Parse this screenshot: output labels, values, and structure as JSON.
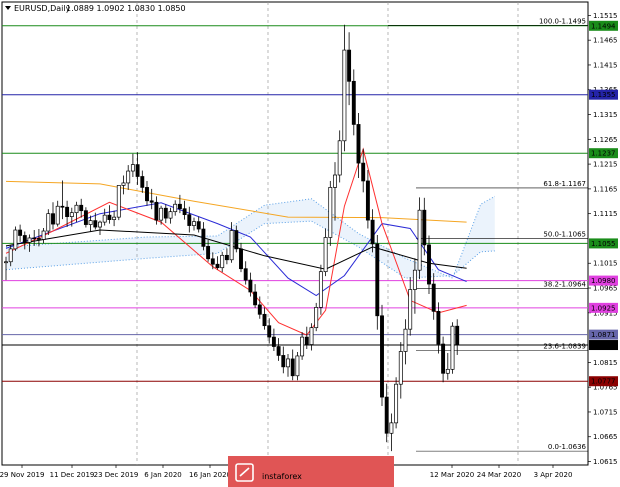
{
  "chart_data": {
    "type": "candlestick",
    "title": "EURUSD,Daily",
    "ohlc_header": "1.0889 1.0902 1.0830 1.0850",
    "ylim": [
      1.0608,
      1.1542
    ],
    "y_ticks": [
      {
        "value": 1.1515,
        "label": "1.1515"
      },
      {
        "value": 1.1465,
        "label": "1.1465"
      },
      {
        "value": 1.1415,
        "label": "1.1415"
      },
      {
        "value": 1.1365,
        "label": "1.1365"
      },
      {
        "value": 1.1315,
        "label": "1.1315"
      },
      {
        "value": 1.1265,
        "label": "1.1265"
      },
      {
        "value": 1.1215,
        "label": "1.1215"
      },
      {
        "value": 1.1165,
        "label": "1.1165"
      },
      {
        "value": 1.1115,
        "label": "1.1115"
      },
      {
        "value": 1.1015,
        "label": "1.1015"
      },
      {
        "value": 1.0965,
        "label": "1.0965"
      },
      {
        "value": 1.0915,
        "label": "1.0915"
      },
      {
        "value": 1.0815,
        "label": "1.0815"
      },
      {
        "value": 1.0765,
        "label": "1.0765"
      },
      {
        "value": 1.0715,
        "label": "1.0715"
      },
      {
        "value": 1.0665,
        "label": "1.0665"
      },
      {
        "value": 1.0615,
        "label": "1.0615"
      }
    ],
    "x_labels": [
      "29 Nov 2019",
      "11 Dec 2019",
      "23 Dec 2019",
      "6 Jan 2020",
      "16 Jan 2020",
      "",
      "",
      "",
      "12 Mar 2020",
      "24 Mar 2020",
      "3 Apr 2020"
    ],
    "h_levels": [
      {
        "value": 1.1494,
        "label": "1.1494",
        "color": "#1a8c1a"
      },
      {
        "value": 1.1355,
        "label": "1.1355",
        "color": "#2424a8"
      },
      {
        "value": 1.1237,
        "label": "1.1237",
        "color": "#1a8c1a"
      },
      {
        "value": 1.1055,
        "label": "1.1055",
        "color": "#1a8c1a"
      },
      {
        "value": 1.098,
        "label": "1.0980",
        "color": "#e040e0"
      },
      {
        "value": 1.0925,
        "label": "1.0925",
        "color": "#e040e0"
      },
      {
        "value": 1.0871,
        "label": "1.0871",
        "color": "#6666aa"
      },
      {
        "value": 1.085,
        "label": "1.0850",
        "color": "#000000"
      },
      {
        "value": 1.0777,
        "label": "1.0777",
        "color": "#8b0000"
      }
    ],
    "fib_levels": [
      {
        "value": 1.1495,
        "label": "100.0-1.1495"
      },
      {
        "value": 1.1167,
        "label": "61.8-1.1167"
      },
      {
        "value": 1.1065,
        "label": "50.0-1.1065"
      },
      {
        "value": 1.0964,
        "label": "38.2-1.0964"
      },
      {
        "value": 1.0839,
        "label": "23.6-1.0839"
      },
      {
        "value": 1.0636,
        "label": "0.0-1.0636"
      }
    ],
    "candles": [
      [
        1.1016,
        1.1028,
        1.0981,
        1.1018
      ],
      [
        1.1018,
        1.1051,
        1.1009,
        1.1044
      ],
      [
        1.1044,
        1.1089,
        1.104,
        1.1082
      ],
      [
        1.1082,
        1.1093,
        1.1058,
        1.1071
      ],
      [
        1.1071,
        1.1079,
        1.1043,
        1.1057
      ],
      [
        1.1057,
        1.1073,
        1.1038,
        1.1066
      ],
      [
        1.1066,
        1.1082,
        1.105,
        1.1065
      ],
      [
        1.1065,
        1.1084,
        1.1049,
        1.1063
      ],
      [
        1.1063,
        1.1086,
        1.1055,
        1.108
      ],
      [
        1.108,
        1.1124,
        1.1072,
        1.1115
      ],
      [
        1.1115,
        1.1138,
        1.1083,
        1.1094
      ],
      [
        1.1094,
        1.1141,
        1.1089,
        1.113
      ],
      [
        1.113,
        1.1182,
        1.1104,
        1.1128
      ],
      [
        1.1128,
        1.1141,
        1.1088,
        1.1109
      ],
      [
        1.1109,
        1.1127,
        1.1089,
        1.1117
      ],
      [
        1.1117,
        1.1139,
        1.1098,
        1.1132
      ],
      [
        1.1132,
        1.1145,
        1.1107,
        1.1121
      ],
      [
        1.1121,
        1.1128,
        1.1087,
        1.1093
      ],
      [
        1.1093,
        1.1111,
        1.1078,
        1.1101
      ],
      [
        1.1101,
        1.1117,
        1.1083,
        1.1088
      ],
      [
        1.1088,
        1.1101,
        1.1072,
        1.1098
      ],
      [
        1.1098,
        1.1125,
        1.1091,
        1.1112
      ],
      [
        1.1112,
        1.1132,
        1.1095,
        1.1103
      ],
      [
        1.1103,
        1.1121,
        1.109,
        1.1108
      ],
      [
        1.1108,
        1.1138,
        1.1102,
        1.1172
      ],
      [
        1.1172,
        1.1192,
        1.1154,
        1.1177
      ],
      [
        1.1177,
        1.1213,
        1.1163,
        1.1201
      ],
      [
        1.1201,
        1.1236,
        1.1189,
        1.1214
      ],
      [
        1.1214,
        1.1239,
        1.1173,
        1.119
      ],
      [
        1.119,
        1.1202,
        1.1157,
        1.1168
      ],
      [
        1.1168,
        1.1181,
        1.1131,
        1.1141
      ],
      [
        1.1141,
        1.1165,
        1.1124,
        1.1138
      ],
      [
        1.1138,
        1.115,
        1.1093,
        1.1102
      ],
      [
        1.1102,
        1.1131,
        1.1093,
        1.1126
      ],
      [
        1.1126,
        1.1134,
        1.1096,
        1.1106
      ],
      [
        1.1106,
        1.1127,
        1.1095,
        1.1119
      ],
      [
        1.1119,
        1.1142,
        1.1111,
        1.1134
      ],
      [
        1.1134,
        1.1153,
        1.1116,
        1.1125
      ],
      [
        1.1125,
        1.1141,
        1.1103,
        1.1113
      ],
      [
        1.1113,
        1.1129,
        1.1077,
        1.1091
      ],
      [
        1.1091,
        1.1107,
        1.1081,
        1.1099
      ],
      [
        1.1099,
        1.1109,
        1.1077,
        1.1084
      ],
      [
        1.1084,
        1.1098,
        1.1041,
        1.1049
      ],
      [
        1.1049,
        1.1062,
        1.1018,
        1.1024
      ],
      [
        1.1024,
        1.1037,
        1.1003,
        1.1013
      ],
      [
        1.1013,
        1.1029,
        1.1002,
        1.1006
      ],
      [
        1.1006,
        1.1038,
        1.0997,
        1.1031
      ],
      [
        1.1031,
        1.1045,
        1.1013,
        1.1022
      ],
      [
        1.1022,
        1.1098,
        1.1016,
        1.1081
      ],
      [
        1.1081,
        1.1091,
        1.1037,
        1.1044
      ],
      [
        1.1044,
        1.1056,
        1.0997,
        1.1004
      ],
      [
        1.1004,
        1.1019,
        1.0972,
        1.0981
      ],
      [
        1.0981,
        1.0996,
        1.0948,
        1.0957
      ],
      [
        1.0957,
        1.0973,
        1.0925,
        1.0931
      ],
      [
        1.0931,
        1.0948,
        1.0903,
        1.0912
      ],
      [
        1.0912,
        1.0926,
        1.0881,
        1.0889
      ],
      [
        1.0889,
        1.0904,
        1.0853,
        1.0866
      ],
      [
        1.0866,
        1.0883,
        1.0838,
        1.0847
      ],
      [
        1.0847,
        1.0864,
        1.0818,
        1.0829
      ],
      [
        1.0829,
        1.0847,
        1.0793,
        1.0806
      ],
      [
        1.0806,
        1.0832,
        1.0786,
        1.0822
      ],
      [
        1.0822,
        1.0841,
        1.0779,
        1.0788
      ],
      [
        1.0788,
        1.0836,
        1.0779,
        1.0828
      ],
      [
        1.0828,
        1.0876,
        1.082,
        1.0866
      ],
      [
        1.0866,
        1.0887,
        1.0842,
        1.0851
      ],
      [
        1.0851,
        1.0894,
        1.0839,
        1.0885
      ],
      [
        1.0885,
        1.0935,
        1.0878,
        1.0926
      ],
      [
        1.0926,
        1.1012,
        1.0911,
        1.0998
      ],
      [
        1.0998,
        1.1085,
        1.0989,
        1.1067
      ],
      [
        1.1067,
        1.1181,
        1.105,
        1.1168
      ],
      [
        1.1168,
        1.1219,
        1.1101,
        1.1193
      ],
      [
        1.1193,
        1.1283,
        1.1178,
        1.1262
      ],
      [
        1.1262,
        1.1496,
        1.1241,
        1.1445
      ],
      [
        1.1445,
        1.1481,
        1.1334,
        1.1382
      ],
      [
        1.1382,
        1.1406,
        1.1273,
        1.1295
      ],
      [
        1.1295,
        1.1318,
        1.1187,
        1.1217
      ],
      [
        1.1217,
        1.1246,
        1.1158,
        1.1181
      ],
      [
        1.1181,
        1.1203,
        1.1085,
        1.1102
      ],
      [
        1.1102,
        1.1124,
        1.1037,
        1.1054
      ],
      [
        1.1054,
        1.1072,
        1.0881,
        1.0909
      ],
      [
        1.0909,
        1.0931,
        1.0727,
        1.0745
      ],
      [
        1.0745,
        1.0772,
        1.0654,
        1.0672
      ],
      [
        1.0672,
        1.0712,
        1.0636,
        1.0693
      ],
      [
        1.0693,
        1.0785,
        1.0682,
        1.0771
      ],
      [
        1.0771,
        1.0856,
        1.0742,
        1.0837
      ],
      [
        1.0837,
        1.0902,
        1.0811,
        1.0882
      ],
      [
        1.0882,
        1.0987,
        1.0869,
        1.0962
      ],
      [
        1.0962,
        1.1025,
        1.0913,
        1.1001
      ],
      [
        1.1001,
        1.1148,
        1.0983,
        1.1122
      ],
      [
        1.1122,
        1.1147,
        1.1031,
        1.1052
      ],
      [
        1.1052,
        1.1071,
        1.0953,
        1.0973
      ],
      [
        1.0973,
        1.0995,
        1.0901,
        1.0918
      ],
      [
        1.0918,
        1.0936,
        1.0833,
        1.0852
      ],
      [
        1.0852,
        1.0867,
        1.0775,
        1.0793
      ],
      [
        1.0793,
        1.0834,
        1.078,
        1.0801
      ],
      [
        1.0801,
        1.0896,
        1.0792,
        1.0888
      ],
      [
        1.0888,
        1.0902,
        1.083,
        1.085
      ]
    ],
    "overlays": [
      {
        "name": "",
        "color": "#f5a623",
        "values": [
          [
            0,
            1.118
          ],
          [
            20,
            1.1175
          ],
          [
            40,
            1.114
          ],
          [
            60,
            1.1108
          ],
          [
            80,
            1.1107
          ],
          [
            98,
            1.1098
          ]
        ]
      },
      {
        "name": "",
        "color": "#2b2bd6",
        "values": [
          [
            0,
            1.1045
          ],
          [
            20,
            1.1115
          ],
          [
            33,
            1.1137
          ],
          [
            45,
            1.1095
          ],
          [
            52,
            1.1068
          ],
          [
            60,
            1.0985
          ],
          [
            66,
            1.095
          ],
          [
            72,
            1.099
          ],
          [
            80,
            1.1095
          ],
          [
            86,
            1.1085
          ],
          [
            92,
            1.1002
          ],
          [
            98,
            1.0978
          ]
        ]
      },
      {
        "name": "",
        "color": "#ff3030",
        "values": [
          [
            0,
            1.1035
          ],
          [
            10,
            1.108
          ],
          [
            22,
            1.1138
          ],
          [
            33,
            1.1098
          ],
          [
            44,
            1.1008
          ],
          [
            52,
            1.096
          ],
          [
            58,
            1.0895
          ],
          [
            64,
            1.087
          ],
          [
            68,
            1.092
          ],
          [
            72,
            1.113
          ],
          [
            76,
            1.1245
          ],
          [
            80,
            1.1095
          ],
          [
            86,
            1.094
          ],
          [
            92,
            1.0915
          ],
          [
            98,
            1.093
          ]
        ]
      },
      {
        "name": "",
        "color": "#000000",
        "values": [
          [
            0,
            1.105
          ],
          [
            20,
            1.1082
          ],
          [
            40,
            1.1072
          ],
          [
            55,
            1.103
          ],
          [
            68,
            1.1003
          ],
          [
            78,
            1.1048
          ],
          [
            90,
            1.1015
          ],
          [
            98,
            1.1005
          ]
        ]
      }
    ],
    "cloud": {
      "color": "#5aa0e6",
      "upper": [
        [
          0,
          1.1048
        ],
        [
          30,
          1.1068
        ],
        [
          45,
          1.107
        ],
        [
          55,
          1.1132
        ],
        [
          65,
          1.1145
        ],
        [
          75,
          1.1075
        ],
        [
          85,
          1.1025
        ],
        [
          95,
          1.0985
        ],
        [
          101,
          1.1134
        ],
        [
          104,
          1.115
        ]
      ],
      "lower": [
        [
          0,
          1.1002
        ],
        [
          30,
          1.1025
        ],
        [
          45,
          1.1035
        ],
        [
          55,
          1.1095
        ],
        [
          65,
          1.11
        ],
        [
          75,
          1.1048
        ],
        [
          85,
          1.0985
        ],
        [
          95,
          1.099
        ],
        [
          101,
          1.1038
        ],
        [
          104,
          1.104
        ]
      ]
    }
  },
  "watermark": {
    "logo_text": "instaforex"
  }
}
